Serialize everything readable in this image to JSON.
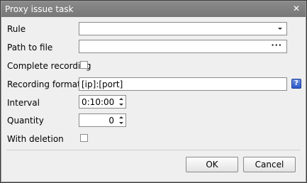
{
  "window": {
    "title": "Proxy issue task",
    "close_glyph": "✕"
  },
  "fields": {
    "rule": {
      "label": "Rule",
      "value": ""
    },
    "path": {
      "label": "Path to file",
      "value": "",
      "browse_label": "···"
    },
    "complete_recording": {
      "label": "Complete recording",
      "checked": false
    },
    "recording_format": {
      "label": "Recording format",
      "value": "[ip]:[port]",
      "help_label": "?"
    },
    "interval": {
      "label": "Interval",
      "value": "0:10:00"
    },
    "quantity": {
      "label": "Quantity",
      "value": "0"
    },
    "with_deletion": {
      "label": "With deletion",
      "checked": false
    }
  },
  "buttons": {
    "ok": "OK",
    "cancel": "Cancel"
  }
}
